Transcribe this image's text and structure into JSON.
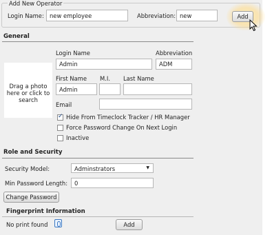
{
  "new_operator": {
    "legend": "Add New Operator",
    "login_label": "Login Name:",
    "login_value": "new employee",
    "abbrev_label": "Abbreviation:",
    "abbrev_value": "new",
    "add_label": "Add"
  },
  "general": {
    "title": "General",
    "photo_text_1": "Drag a photo",
    "photo_text_2": "here or click to",
    "photo_text_3": "search",
    "login_name_label": "Login Name",
    "abbreviation_label": "Abbreviation",
    "login_name_value": "Admin",
    "abbreviation_value": "ADM",
    "first_name_label": "First Name",
    "mi_label": "M.I.",
    "last_name_label": "Last Name",
    "first_name_value": "Admin",
    "mi_value": "",
    "last_name_value": "",
    "email_label": "Email",
    "email_value": "",
    "checkboxes": [
      {
        "label": "Hide From Timeclock Tracker / HR Manager",
        "checked": true
      },
      {
        "label": "Force Password Change On Next Login",
        "checked": false
      },
      {
        "label": "Inactive",
        "checked": false
      }
    ]
  },
  "security": {
    "title": "Role and Security",
    "model_label": "Security Model:",
    "model_value": "Adminstrators",
    "min_pw_label": "Min Password Length:",
    "min_pw_value": "0",
    "change_pw_label": "Change Password"
  },
  "fingerprint": {
    "title": "Fingerprint Information",
    "status": "No print found",
    "add_label": "Add"
  },
  "icons": {
    "dropdown": "chevron-down-icon",
    "fingerprint": "fingerprint-icon",
    "cursor": "mouse-pointer-icon"
  }
}
